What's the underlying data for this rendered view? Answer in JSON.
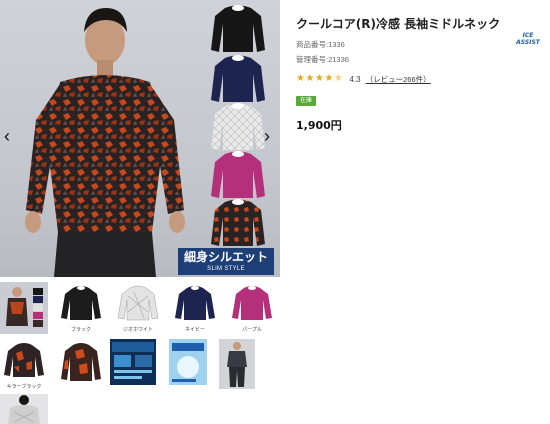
{
  "product": {
    "title": "クールコア(R)冷感 長袖ミドルネック",
    "product_number": "商品番号:1336",
    "management_number": "管理番号:21336",
    "rating": 4.3,
    "rating_text": "4.3",
    "review_link": "（レビュー266件）",
    "status_badge": "在庫",
    "price": "1,900円"
  },
  "brand_logo_text": "ICE ASSIST",
  "hero": {
    "badge_main": "細身シルエット",
    "badge_sub": "SLIM STYLE",
    "prev_arrow": "‹",
    "next_arrow": "›"
  },
  "thumbnails": [
    {
      "caption": "",
      "kind": "model",
      "active": true
    },
    {
      "caption": "ブラック",
      "kind": "shirt",
      "color": "#1c1c1c"
    },
    {
      "caption": "ジオホワイト",
      "kind": "shirt",
      "color": "#e3e3e3"
    },
    {
      "caption": "ネイビー",
      "kind": "shirt",
      "color": "#1d2450"
    },
    {
      "caption": "パープル",
      "kind": "shirt",
      "color": "#b5307a"
    },
    {
      "caption": "キラーブラック",
      "kind": "shirt",
      "color": "#3a2a26"
    },
    {
      "caption": "",
      "kind": "shirt",
      "color": "#4a2620"
    },
    {
      "caption": "",
      "kind": "promo",
      "color": "#1a4a7a"
    },
    {
      "caption": "",
      "kind": "promo2",
      "color": "#6fb4dc"
    },
    {
      "caption": "",
      "kind": "model2",
      "color": "#3a3a44"
    },
    {
      "caption": "",
      "kind": "back",
      "color": "#cfcfcf"
    }
  ],
  "colors": {
    "star": "#e8a91f",
    "badge_green": "#5aa83c",
    "slim_badge": "#1e3e78",
    "active_thumb": "#e6b500"
  }
}
